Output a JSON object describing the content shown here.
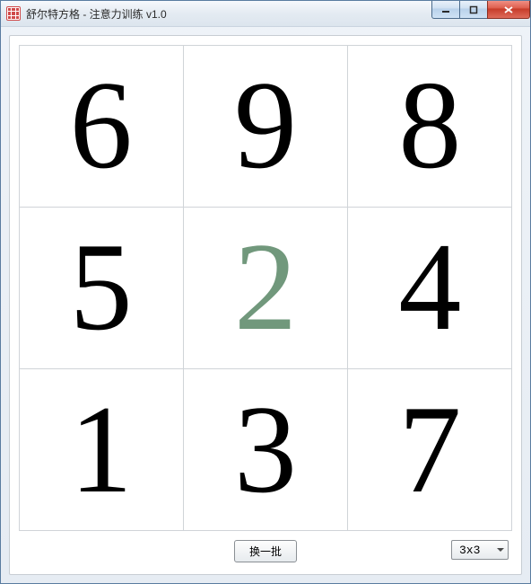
{
  "window": {
    "title": "舒尔特方格 - 注意力训练 v1.0"
  },
  "grid": {
    "size": 3,
    "cells": [
      {
        "value": "6",
        "highlight": false
      },
      {
        "value": "9",
        "highlight": false
      },
      {
        "value": "8",
        "highlight": false
      },
      {
        "value": "5",
        "highlight": false
      },
      {
        "value": "2",
        "highlight": true
      },
      {
        "value": "4",
        "highlight": false
      },
      {
        "value": "1",
        "highlight": false
      },
      {
        "value": "3",
        "highlight": false
      },
      {
        "value": "7",
        "highlight": false
      }
    ]
  },
  "controls": {
    "shuffle_label": "换一批",
    "grid_size_selected": "3x3"
  }
}
